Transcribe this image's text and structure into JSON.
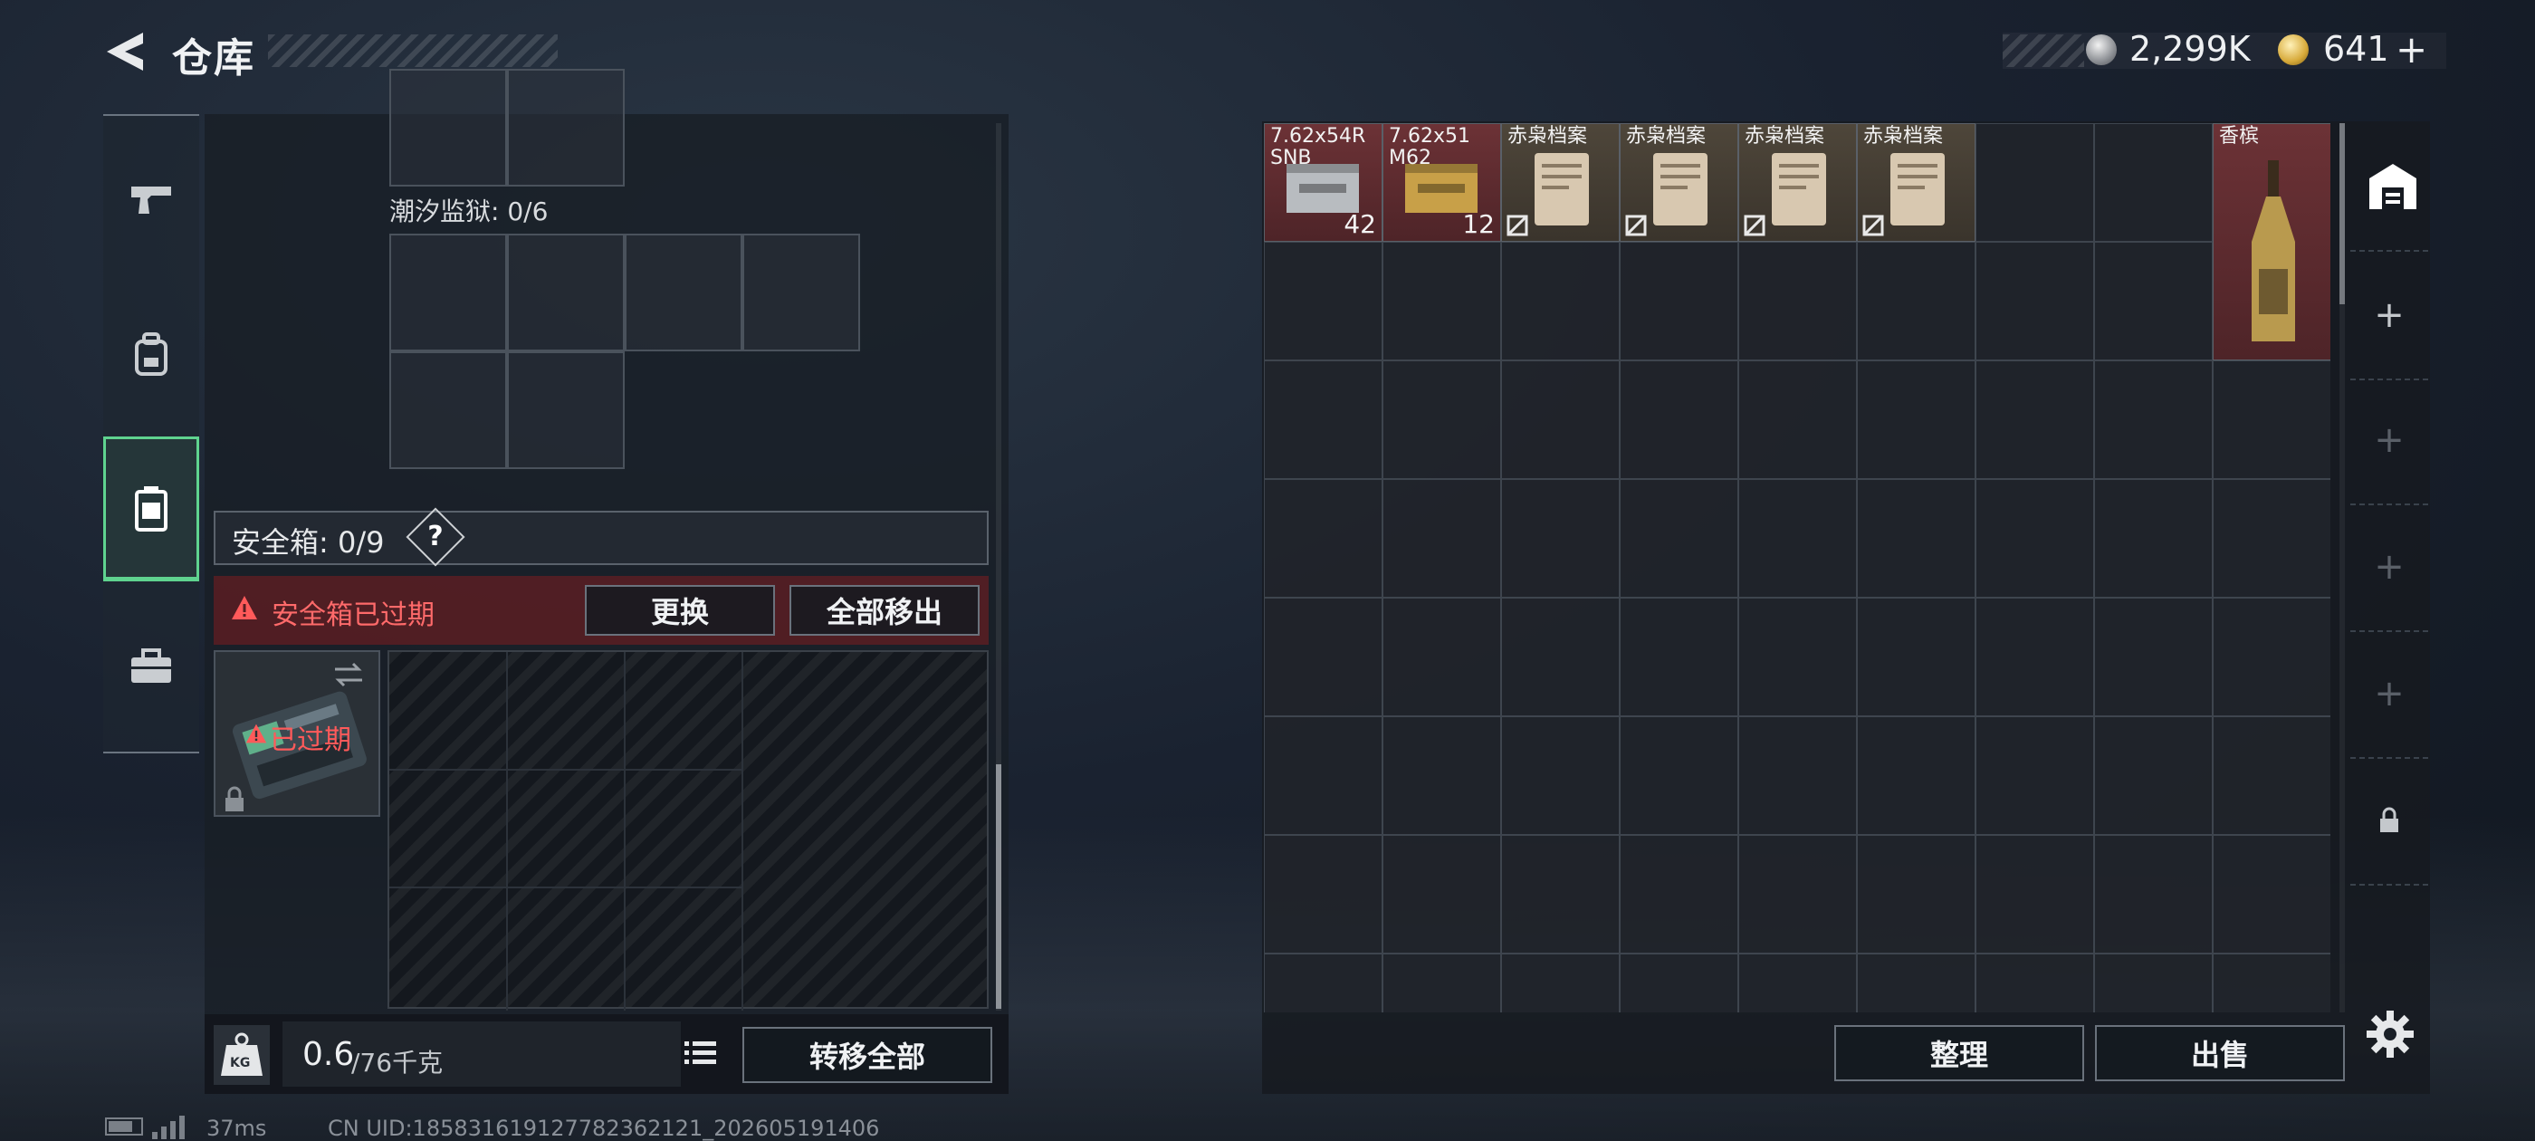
{
  "header": {
    "title": "仓库",
    "silver_amount": "2,299K",
    "gold_amount": "641",
    "gold_add": "+"
  },
  "colors": {
    "accent_green": "#5fd38f",
    "warning_red": "#ff6a6a",
    "item_red_bg": "#6c3236"
  },
  "left_tabs": [
    {
      "icon": "pistol-icon"
    },
    {
      "icon": "backpack-icon"
    },
    {
      "icon": "safebox-icon",
      "active": true
    },
    {
      "icon": "toolbox-icon"
    }
  ],
  "container_label": "潮汐监狱: 0/6",
  "safebox": {
    "label": "安全箱: 0/9",
    "help": "?",
    "warning": "安全箱已过期",
    "replace_button": "更换",
    "remove_all_button": "全部移出",
    "expired_badge": "已过期"
  },
  "weight": {
    "current": "0.6",
    "max": "/76千克",
    "kg_badge": "KG"
  },
  "transfer_all_button": "转移全部",
  "stash_items": [
    {
      "name": "7.62x54R\nSNB",
      "count": "42",
      "type": "ammo-box"
    },
    {
      "name": "7.62x51\nM62",
      "count": "12",
      "type": "ammo-box"
    },
    {
      "name": "赤枭档案",
      "count": "",
      "type": "document"
    },
    {
      "name": "赤枭档案",
      "count": "",
      "type": "document"
    },
    {
      "name": "赤枭档案",
      "count": "",
      "type": "document"
    },
    {
      "name": "赤枭档案",
      "count": "",
      "type": "document"
    },
    {
      "name": "香槟",
      "count": "",
      "type": "champagne"
    }
  ],
  "stash_side": [
    "warehouse-icon",
    "+",
    "+",
    "+",
    "+",
    "lock-icon"
  ],
  "sort_button": "整理",
  "sell_button": "出售",
  "status": {
    "ping": "37ms",
    "uid": "CN UID:185831619127782362121_202605191406"
  }
}
